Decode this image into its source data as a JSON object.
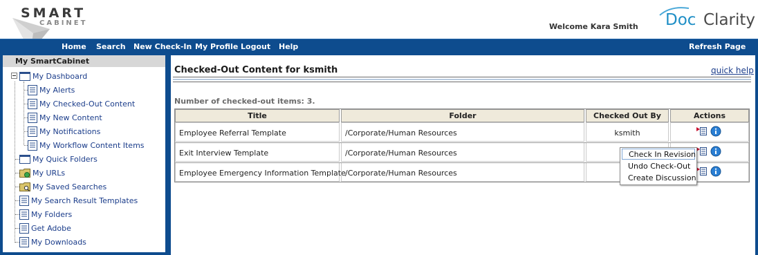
{
  "brand": {
    "logo_line1": "SMART",
    "logo_line2": "CABINET",
    "partner_logo_part1": "Doc",
    "partner_logo_part2": "Clarity"
  },
  "header": {
    "welcome": "Welcome Kara Smith"
  },
  "nav": {
    "items": [
      "Home",
      "Search",
      "New Check-In",
      "My Profile",
      "Logout",
      "Help"
    ],
    "refresh": "Refresh Page",
    "bg_color": "#0e4c8e"
  },
  "sidebar": {
    "title": "My SmartCabinet",
    "items": [
      {
        "label": "My Dashboard",
        "icon": "dashboard-icon"
      },
      {
        "label": "My Alerts",
        "icon": "page-icon"
      },
      {
        "label": "My Checked-Out Content",
        "icon": "page-icon"
      },
      {
        "label": "My New Content",
        "icon": "page-icon"
      },
      {
        "label": "My Notifications",
        "icon": "page-icon"
      },
      {
        "label": "My Workflow Content Items",
        "icon": "page-icon"
      },
      {
        "label": "My Quick Folders",
        "icon": "window-icon"
      },
      {
        "label": "My URLs",
        "icon": "folder-globe-icon"
      },
      {
        "label": "My Saved Searches",
        "icon": "folder-search-icon"
      },
      {
        "label": "My Search Result Templates",
        "icon": "page-icon"
      },
      {
        "label": "My Folders",
        "icon": "page-icon"
      },
      {
        "label": "Get Adobe",
        "icon": "page-icon"
      },
      {
        "label": "My Downloads",
        "icon": "page-icon"
      }
    ]
  },
  "main": {
    "title": "Checked-Out Content for ksmith",
    "quick_help": "quick help",
    "count_text": "Number of checked-out items: 3.",
    "columns": [
      "Title",
      "Folder",
      "Checked Out By",
      "Actions"
    ],
    "rows": [
      {
        "title": "Employee Referral Template",
        "folder": "/Corporate/Human Resources",
        "checked_out_by": "ksmith"
      },
      {
        "title": "Exit Interview Template",
        "folder": "/Corporate/Human Resources",
        "checked_out_by": "k"
      },
      {
        "title": "Employee Emergency Information Template",
        "folder": "/Corporate/Human Resources",
        "checked_out_by": "k"
      }
    ]
  },
  "context_menu": {
    "items": [
      "Check In Revision",
      "Undo Check-Out",
      "Create Discussion"
    ],
    "highlighted": "Check In Revision"
  }
}
